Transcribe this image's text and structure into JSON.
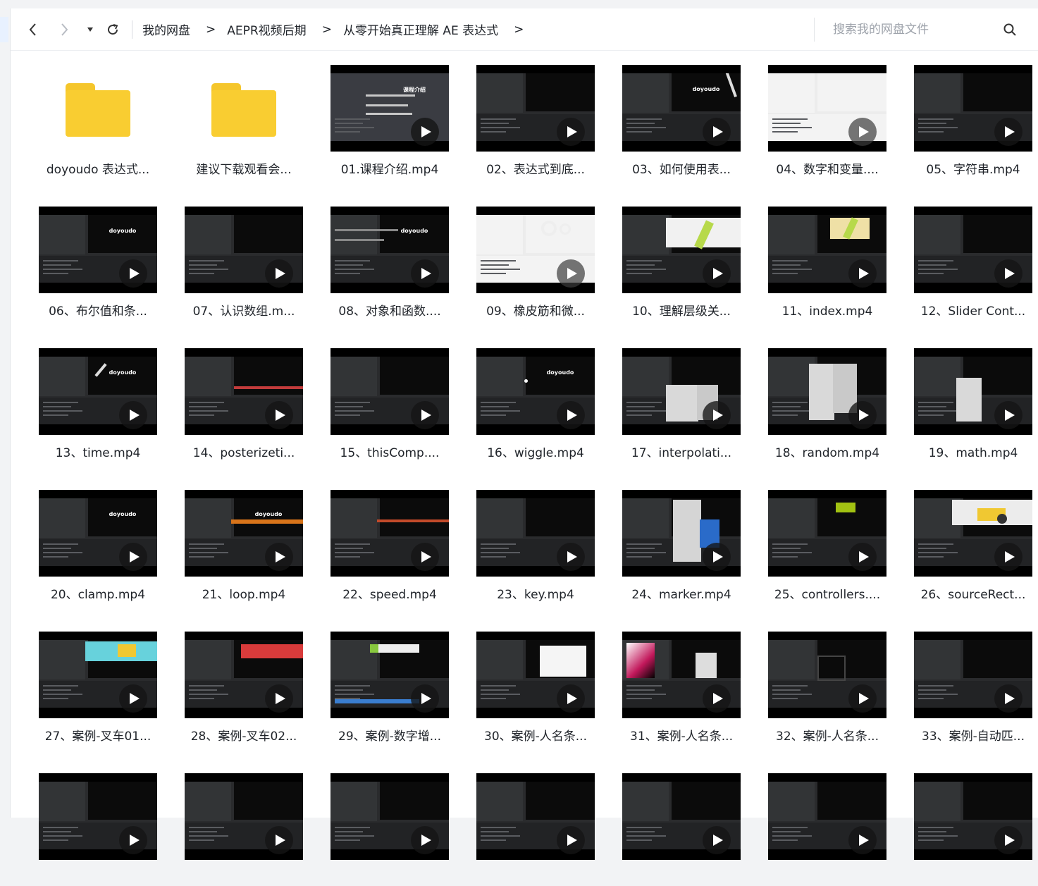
{
  "toolbar": {
    "breadcrumb": [
      {
        "label": "我的网盘"
      },
      {
        "label": "AEPR视频后期"
      },
      {
        "label": "从零开始真正理解 AE 表达式"
      }
    ],
    "separator": ">",
    "search_placeholder": "搜索我的网盘文件"
  },
  "icons": {
    "back": "chevron-left-icon",
    "forward": "chevron-right-icon",
    "history": "caret-down-icon",
    "refresh": "refresh-icon",
    "search": "search-icon",
    "folder": "folder-icon",
    "play": "play-icon"
  },
  "colors": {
    "folder": "#f9cd31",
    "text": "#1f2329",
    "placeholder": "#9ea3ab",
    "thumb_bg": "#000000"
  },
  "files": [
    {
      "label": "doyoudo 表达式...",
      "type": "folder"
    },
    {
      "label": "建议下载观看会...",
      "type": "folder"
    },
    {
      "label": "01.课程介绍.mp4",
      "type": "video",
      "thumb_text": "课程介绍",
      "style": "slate"
    },
    {
      "label": "02、表达式到底...",
      "type": "video",
      "style": "dark"
    },
    {
      "label": "03、如何使用表...",
      "type": "video",
      "thumb_text": "doyoudo",
      "style": "dark"
    },
    {
      "label": "04、数字和变量....",
      "type": "video",
      "style": "light"
    },
    {
      "label": "05、字符串.mp4",
      "type": "video",
      "style": "dark"
    },
    {
      "label": "06、布尔值和条...",
      "type": "video",
      "thumb_text": "doyoudo",
      "style": "dark"
    },
    {
      "label": "07、认识数组.m...",
      "type": "video",
      "style": "dark"
    },
    {
      "label": "08、对象和函数....",
      "type": "video",
      "thumb_text": "doyoudo",
      "style": "dark"
    },
    {
      "label": "09、橡皮筋和微...",
      "type": "video",
      "style": "light"
    },
    {
      "label": "10、理解层级关...",
      "type": "video",
      "style": "dark"
    },
    {
      "label": "11、index.mp4",
      "type": "video",
      "style": "dark"
    },
    {
      "label": "12、Slider Cont...",
      "type": "video",
      "style": "dark"
    },
    {
      "label": "13、time.mp4",
      "type": "video",
      "thumb_text": "doyoudo",
      "style": "dark"
    },
    {
      "label": "14、posterizeti...",
      "type": "video",
      "style": "dark"
    },
    {
      "label": "15、thisComp....",
      "type": "video",
      "style": "dark"
    },
    {
      "label": "16、wiggle.mp4",
      "type": "video",
      "thumb_text": "doyoudo",
      "style": "dark"
    },
    {
      "label": "17、interpolati...",
      "type": "video",
      "style": "dark"
    },
    {
      "label": "18、random.mp4",
      "type": "video",
      "style": "dark"
    },
    {
      "label": "19、math.mp4",
      "type": "video",
      "style": "dark"
    },
    {
      "label": "20、clamp.mp4",
      "type": "video",
      "thumb_text": "doyoudo",
      "style": "dark"
    },
    {
      "label": "21、loop.mp4",
      "type": "video",
      "thumb_text": "doyoudo",
      "style": "dark"
    },
    {
      "label": "22、speed.mp4",
      "type": "video",
      "style": "dark"
    },
    {
      "label": "23、key.mp4",
      "type": "video",
      "style": "dark"
    },
    {
      "label": "24、marker.mp4",
      "type": "video",
      "style": "dark"
    },
    {
      "label": "25、controllers....",
      "type": "video",
      "style": "dark"
    },
    {
      "label": "26、sourceRect...",
      "type": "video",
      "style": "dark"
    },
    {
      "label": "27、案例-叉车01...",
      "type": "video",
      "style": "dark"
    },
    {
      "label": "28、案例-叉车02...",
      "type": "video",
      "style": "dark"
    },
    {
      "label": "29、案例-数字增...",
      "type": "video",
      "style": "dark"
    },
    {
      "label": "30、案例-人名条...",
      "type": "video",
      "style": "dark"
    },
    {
      "label": "31、案例-人名条...",
      "type": "video",
      "style": "dark"
    },
    {
      "label": "32、案例-人名条...",
      "type": "video",
      "style": "dark"
    },
    {
      "label": "33、案例-自动匹...",
      "type": "video",
      "style": "dark"
    },
    {
      "label": "",
      "type": "video",
      "style": "dark"
    },
    {
      "label": "",
      "type": "video",
      "style": "dark"
    },
    {
      "label": "",
      "type": "video",
      "style": "dark"
    },
    {
      "label": "",
      "type": "video",
      "style": "dark"
    },
    {
      "label": "",
      "type": "video",
      "style": "dark"
    },
    {
      "label": "",
      "type": "video",
      "style": "dark"
    },
    {
      "label": "",
      "type": "video",
      "style": "dark"
    }
  ]
}
